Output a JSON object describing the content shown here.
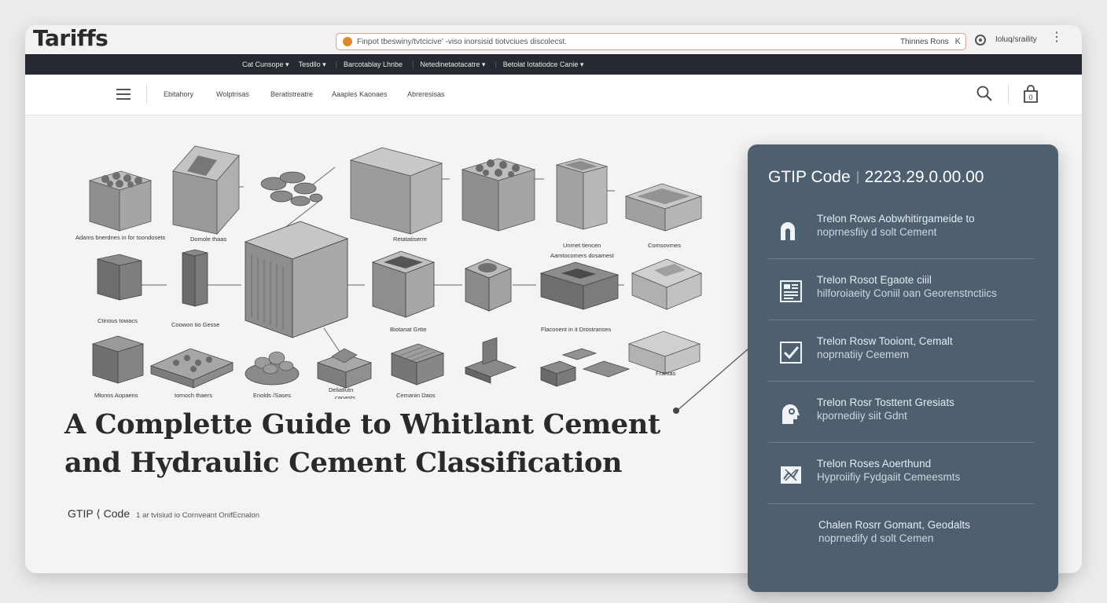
{
  "window": {
    "app_title": "Tariffs",
    "url": "Finpot tbeswiny/tvtcicive' -viso inorsisid tiotvciues discolecst.",
    "url_right": "Thinnes Rons",
    "url_close": "K",
    "profile_label": "Ioluq/sraility",
    "menu_glyph": "⋮"
  },
  "topnav": {
    "items": [
      "Cat Cunsope ▾",
      "Tesdllo ▾",
      "Barcotablay  Lhnbe",
      "Netedinetaotacatre ▾",
      "Betolat  Iotatiodce Canie ▾"
    ]
  },
  "mainnav": {
    "items": [
      "Ebitahory",
      "Wolptrisas",
      "Beratistreatre",
      "Aaaples Kaonaes",
      "Abreresisas"
    ]
  },
  "diagram": {
    "captions": [
      "Adams bnerdnes in for toondosets",
      "Domole thaas",
      "Retatatiserre",
      "Unmet tiencen",
      "Aamtocomers dosamest",
      "Comsovrnes",
      "Ctinous towacs",
      "Coowon tio Gesse",
      "Biotanat Grtte",
      "Flaconent in it Drostranses",
      "Mlonns Aopaens",
      "tornoch thaers",
      "Enolds /Sases",
      "Deliatlutn",
      "caoasts",
      "Cemanin Daos",
      "Frantas"
    ]
  },
  "article": {
    "headline_line1": "A Complette Guide to Whitlant Cement",
    "headline_line2": "and Hydraulic Cement Classification",
    "code_label": "GTIP ⟨ Code",
    "code_desc": "1 ar tvisiud io Cornveant OnifEcnalon"
  },
  "panel": {
    "code_label": "GTIP Code",
    "code_value": "2223.29.0.00.00",
    "bg_color": "#4e5f70",
    "rows": [
      {
        "icon": "arch-icon",
        "line1": "Trelon Rows Aobwhitirgameide to",
        "line2": "noprnesfiiy d solt Cement"
      },
      {
        "icon": "document-grid-icon",
        "line1": "Trelon Rosot Egaote ciiil",
        "line2": "hilforoiaeity Coniil oan Georenstnctiics"
      },
      {
        "icon": "checkbox-icon",
        "line1": "Trelon Rosw Tooiont, Cemalt",
        "line2": "noprnatiiy Ceemem"
      },
      {
        "icon": "head-gear-icon",
        "line1": "Trelon Rosr Tosttent Gresiats",
        "line2": "kpornediiy siit Gdnt"
      },
      {
        "icon": "chart-cross-icon",
        "line1": "Trelon Roses Aoerthund",
        "line2": "Hyproiifiy Fydgaiit Cemeesmts"
      },
      {
        "icon": "",
        "line1": "Chalen Rosrr Gomant, Geodalts",
        "line2": "noprnedify d solt Cemen"
      }
    ]
  }
}
